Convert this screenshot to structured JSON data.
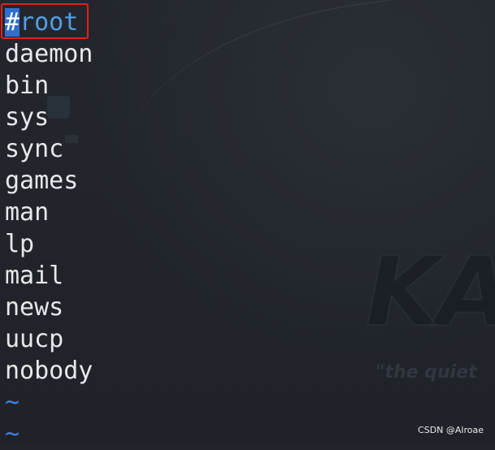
{
  "editor": {
    "first_line": {
      "cursor_char": "#",
      "rest": "root"
    },
    "lines": [
      "daemon",
      "bin",
      "sys",
      "sync",
      "games",
      "man",
      "lp",
      "mail",
      "news",
      "uucp",
      "nobody"
    ],
    "empty_marker": "~"
  },
  "background": {
    "watermark_text": "KA",
    "watermark_tagline": "\"the quiet"
  },
  "credit": "CSDN @Alroae",
  "colors": {
    "background": "#21252b",
    "text": "#e6e8ea",
    "cursor": "#2f6fd0",
    "highlight_box": "#e0201c",
    "tilde": "#3f7fe0"
  }
}
